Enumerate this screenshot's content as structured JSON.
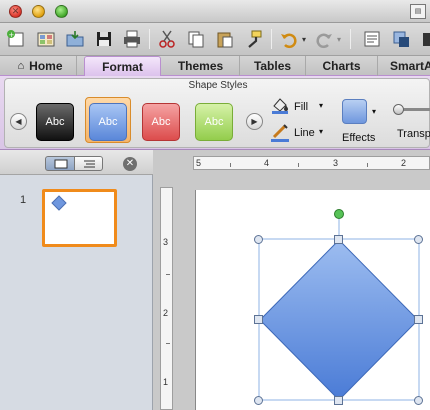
{
  "tabs": [
    {
      "label": "Home"
    },
    {
      "label": "Format"
    },
    {
      "label": "Themes"
    },
    {
      "label": "Tables"
    },
    {
      "label": "Charts"
    },
    {
      "label": "SmartA"
    }
  ],
  "ribbon": {
    "group_title": "Shape Styles",
    "styles": [
      {
        "label": "Abc",
        "color": "#2e2e2e"
      },
      {
        "label": "Abc",
        "color": "#6f9be3"
      },
      {
        "label": "Abc",
        "color": "#e65f5f"
      },
      {
        "label": "Abc",
        "color": "#a5d85e"
      }
    ],
    "fill_label": "Fill",
    "line_label": "Line",
    "effects_label": "Effects",
    "transparency_label": "Transp"
  },
  "slides": [
    {
      "number": "1"
    }
  ],
  "hruler_labels": [
    "5",
    "4",
    "3",
    "2"
  ],
  "vruler_labels": [
    "3",
    "2",
    "1"
  ],
  "colors": {
    "shape_fill_top": "#9dbdf0",
    "shape_fill_bottom": "#4a7bd6",
    "thumb_border": "#f08b1b",
    "tab_accent": "#b98fcf"
  }
}
